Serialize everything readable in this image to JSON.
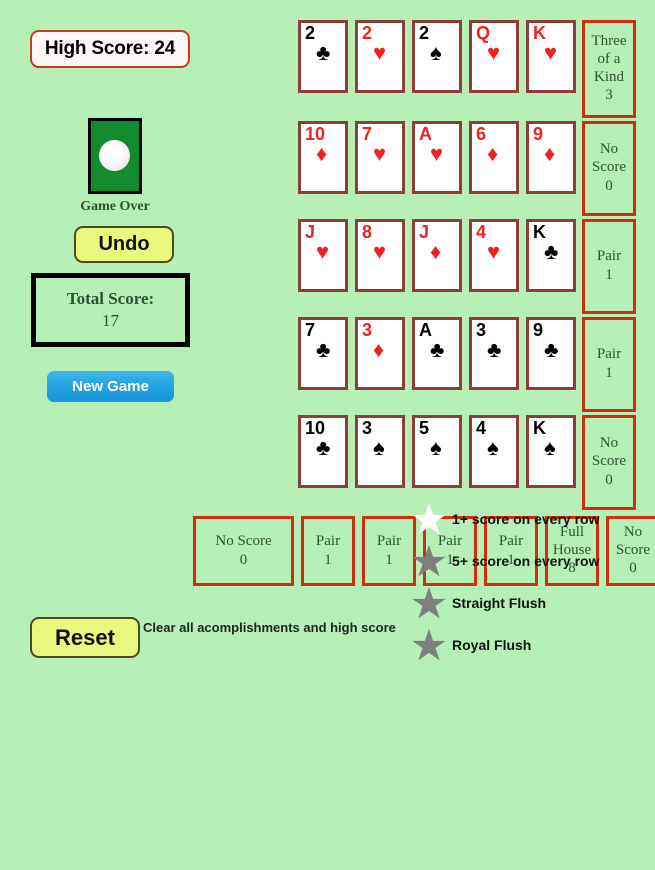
{
  "colors": {
    "background": "#b6f0b6",
    "card_border": "#8e3d3a",
    "score_border": "#cc2f11",
    "score_text": "#2f5130",
    "red_suit": "#ee2222",
    "black_suit": "#000000",
    "high_score_border": "#c4392a",
    "new_game_button": "#22a2e2",
    "yellow_button": "#e8f77e",
    "star_earned": "#ffffff",
    "star_locked": "#7f7f7f"
  },
  "sidebar": {
    "high_score_label": "High Score: 24",
    "deck_icon": "card-back-icon",
    "deck_status": "Game Over",
    "undo_label": "Undo",
    "total_score_label": "Total Score:",
    "total_score_value": "17",
    "new_game_label": "New Game"
  },
  "board": {
    "rows": [
      {
        "cards": [
          {
            "rank": "2",
            "suit": "♣",
            "color": "black"
          },
          {
            "rank": "2",
            "suit": "♥",
            "color": "red"
          },
          {
            "rank": "2",
            "suit": "♠",
            "color": "black"
          },
          {
            "rank": "Q",
            "suit": "♥",
            "color": "red"
          },
          {
            "rank": "K",
            "suit": "♥",
            "color": "red"
          }
        ],
        "score": {
          "name": "Three of a Kind",
          "value": "3"
        }
      },
      {
        "cards": [
          {
            "rank": "10",
            "suit": "♦",
            "color": "red"
          },
          {
            "rank": "7",
            "suit": "♥",
            "color": "red"
          },
          {
            "rank": "A",
            "suit": "♥",
            "color": "red"
          },
          {
            "rank": "6",
            "suit": "♦",
            "color": "red"
          },
          {
            "rank": "9",
            "suit": "♦",
            "color": "red"
          }
        ],
        "score": {
          "name": "No Score",
          "value": "0"
        }
      },
      {
        "cards": [
          {
            "rank": "J",
            "suit": "♥",
            "color": "red"
          },
          {
            "rank": "8",
            "suit": "♥",
            "color": "red"
          },
          {
            "rank": "J",
            "suit": "♦",
            "color": "red"
          },
          {
            "rank": "4",
            "suit": "♥",
            "color": "red"
          },
          {
            "rank": "K",
            "suit": "♣",
            "color": "black"
          }
        ],
        "score": {
          "name": "Pair",
          "value": "1"
        }
      },
      {
        "cards": [
          {
            "rank": "7",
            "suit": "♣",
            "color": "black"
          },
          {
            "rank": "3",
            "suit": "♦",
            "color": "red"
          },
          {
            "rank": "A",
            "suit": "♣",
            "color": "black"
          },
          {
            "rank": "3",
            "suit": "♣",
            "color": "black"
          },
          {
            "rank": "9",
            "suit": "♣",
            "color": "black"
          }
        ],
        "score": {
          "name": "Pair",
          "value": "1"
        }
      },
      {
        "cards": [
          {
            "rank": "10",
            "suit": "♣",
            "color": "black"
          },
          {
            "rank": "3",
            "suit": "♠",
            "color": "black"
          },
          {
            "rank": "5",
            "suit": "♠",
            "color": "black"
          },
          {
            "rank": "4",
            "suit": "♠",
            "color": "black"
          },
          {
            "rank": "K",
            "suit": "♠",
            "color": "black"
          }
        ],
        "score": {
          "name": "No Score",
          "value": "0"
        }
      }
    ],
    "diagonal_score": {
      "name": "No Score",
      "value": "0"
    },
    "column_scores": [
      {
        "name": "Pair",
        "value": "1"
      },
      {
        "name": "Pair",
        "value": "1"
      },
      {
        "name": "Pair",
        "value": "1"
      },
      {
        "name": "Pair",
        "value": "1"
      },
      {
        "name": "Full House",
        "value": "8"
      },
      {
        "name": "No Score",
        "value": "0"
      }
    ]
  },
  "achievements": [
    {
      "label": "1+ score on every row",
      "state": "earned",
      "icon": "star-icon"
    },
    {
      "label": "5+ score on every row",
      "state": "locked",
      "icon": "star-icon"
    },
    {
      "label": "Straight Flush",
      "state": "locked",
      "icon": "star-icon"
    },
    {
      "label": "Royal Flush",
      "state": "locked",
      "icon": "star-icon"
    }
  ],
  "reset": {
    "button_label": "Reset",
    "note": "Clear all acomplishments and high score"
  }
}
